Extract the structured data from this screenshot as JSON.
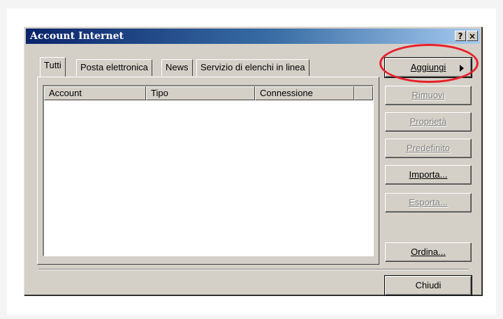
{
  "window": {
    "title": "Account Internet",
    "help_label": "?",
    "close_label": "×"
  },
  "tabs": [
    {
      "label": "Tutti",
      "active": true
    },
    {
      "label": "Posta elettronica",
      "active": false
    },
    {
      "label": "News",
      "active": false
    },
    {
      "label": "Servizio di elenchi in linea",
      "active": false
    }
  ],
  "list": {
    "columns": [
      "Account",
      "Tipo",
      "Connessione",
      ""
    ],
    "rows": []
  },
  "buttons": {
    "aggiungi": {
      "label": "Aggiungi",
      "enabled": true
    },
    "rimuovi": {
      "label": "Rimuovi",
      "enabled": false
    },
    "proprieta": {
      "label": "Proprietà",
      "enabled": false
    },
    "predefinito": {
      "label": "Predefinito",
      "enabled": false
    },
    "importa": {
      "label": "Importa...",
      "enabled": true
    },
    "esporta": {
      "label": "Esporta...",
      "enabled": false
    },
    "ordina": {
      "label": "Ordina...",
      "enabled": true
    },
    "chiudi": {
      "label": "Chiudi",
      "enabled": true
    }
  },
  "colors": {
    "title_gradient_start": "#0a246a",
    "title_gradient_end": "#a6caf0",
    "dialog_face": "#d4d0c8",
    "highlight_circle": "#e8202a"
  }
}
